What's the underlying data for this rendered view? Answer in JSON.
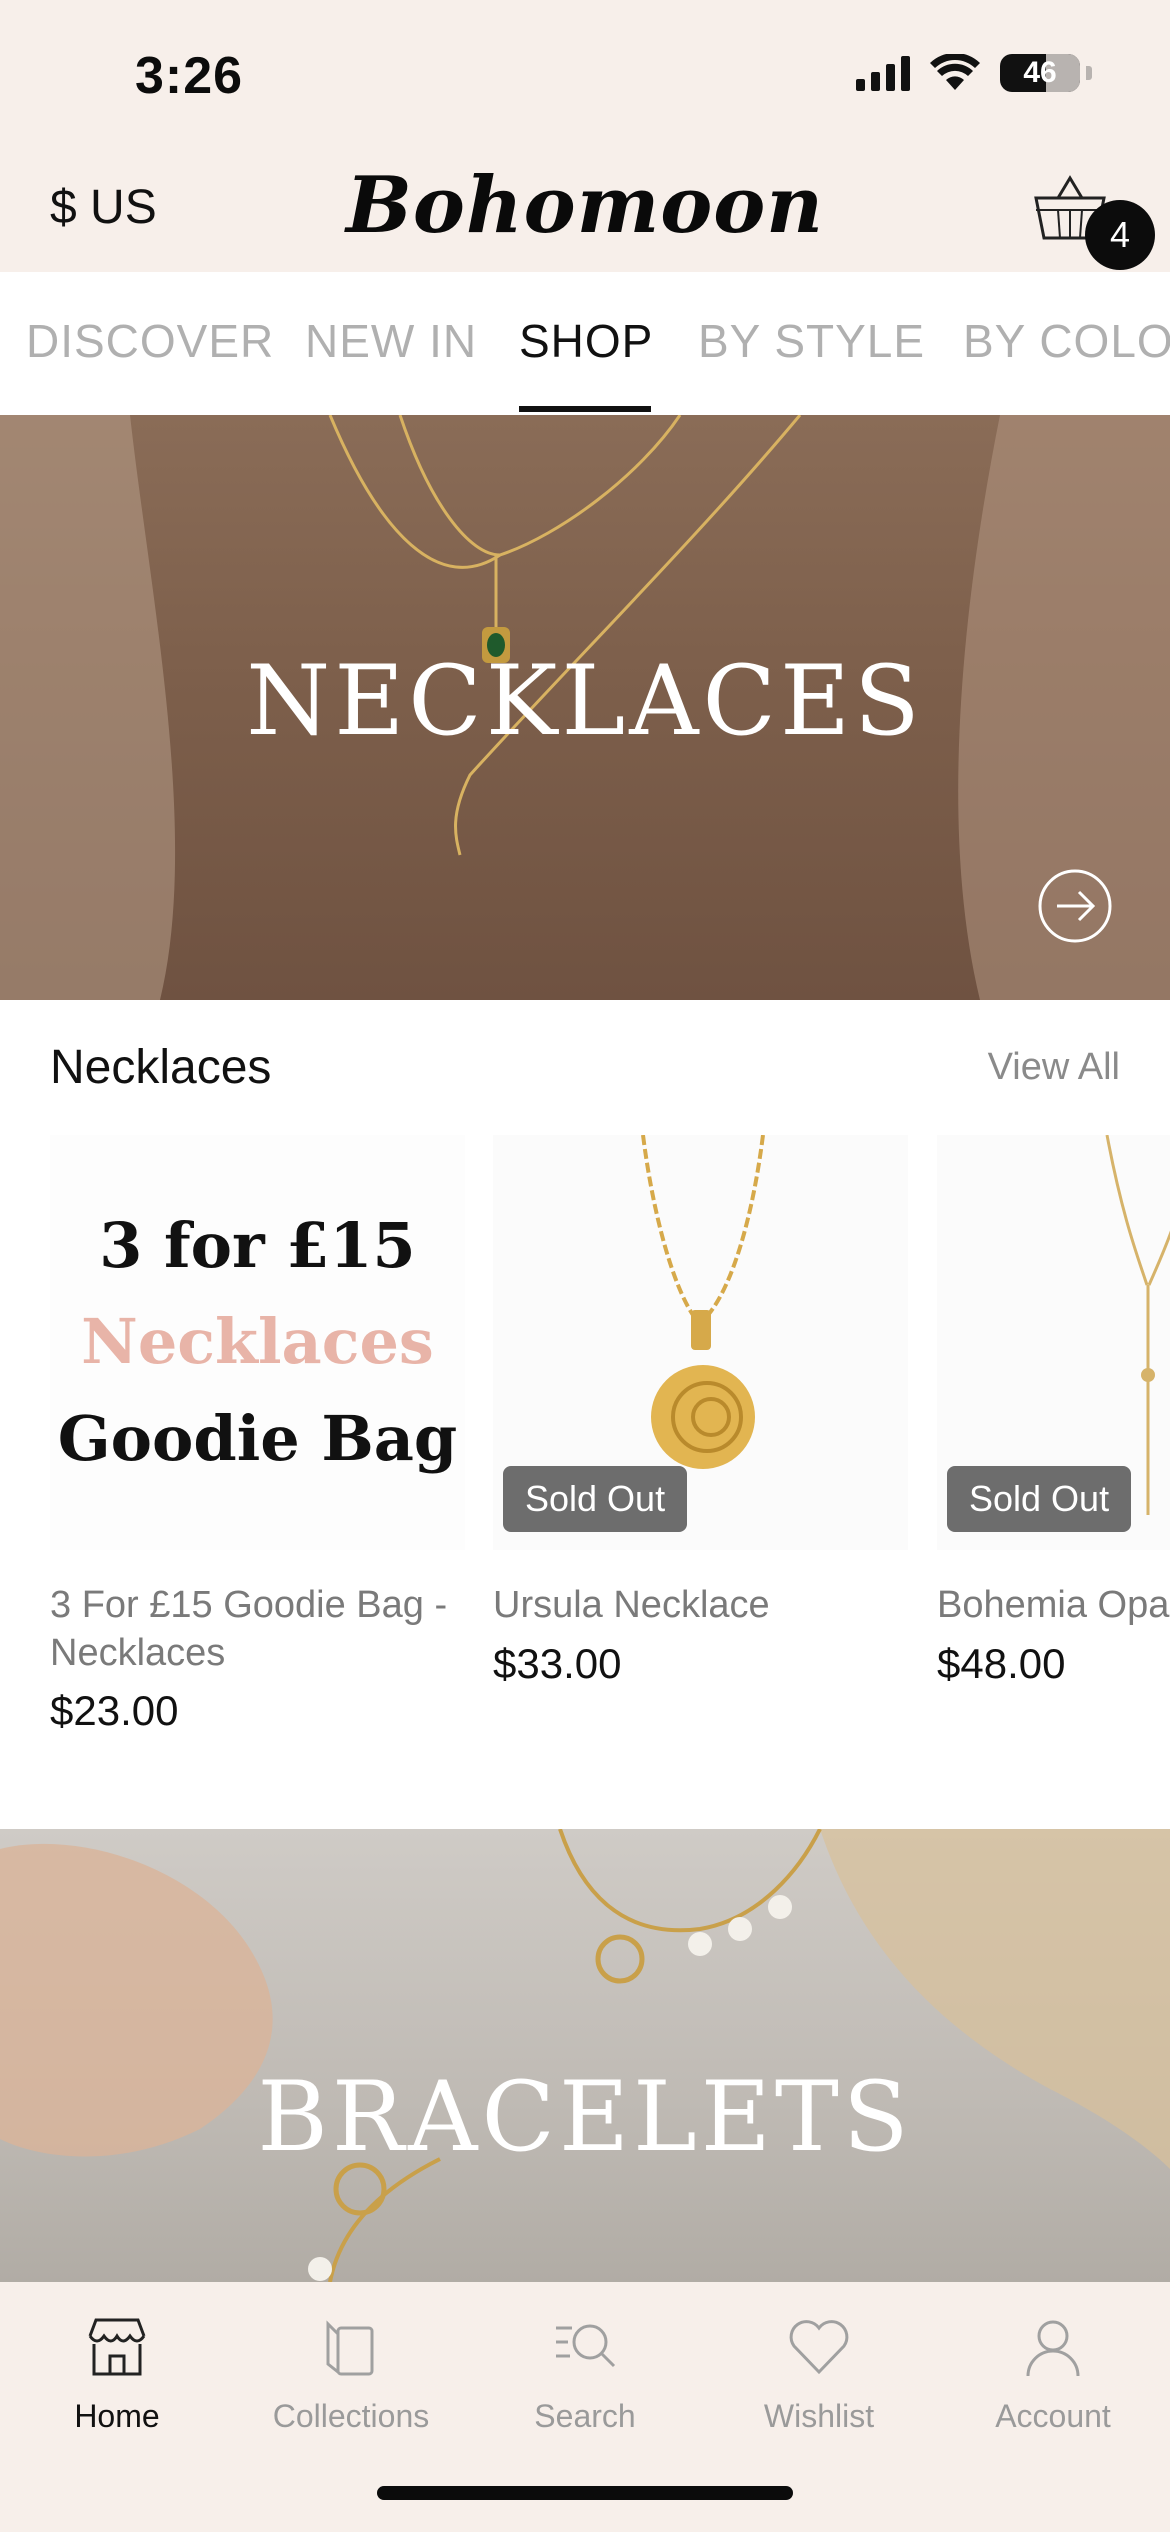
{
  "status_bar": {
    "time": "3:26",
    "battery": "46"
  },
  "header": {
    "currency": "$ US",
    "logo": "Bohomoon",
    "cart_count": "4"
  },
  "tabs": [
    {
      "label": "DISCOVER"
    },
    {
      "label": "NEW IN"
    },
    {
      "label": "SHOP"
    },
    {
      "label": "BY STYLE"
    },
    {
      "label": "BY COLOUR"
    }
  ],
  "active_tab": "SHOP",
  "banners": {
    "necklaces_title": "NECKLACES",
    "bracelets_title": "BRACELETS"
  },
  "section": {
    "title": "Necklaces",
    "view_all": "View All"
  },
  "products": [
    {
      "image_text": [
        "3 for £15",
        "Necklaces",
        "Goodie Bag"
      ],
      "name": "3 For £15 Goodie Bag - Necklaces",
      "price": "$23.00",
      "badge": ""
    },
    {
      "name": "Ursula Necklace",
      "price": "$33.00",
      "badge": "Sold Out"
    },
    {
      "name": "Bohemia Opal Necklace",
      "price": "$48.00",
      "badge": "Sold Out"
    }
  ],
  "bottom_nav": [
    {
      "label": "Home",
      "icon": "store-icon"
    },
    {
      "label": "Collections",
      "icon": "collections-icon"
    },
    {
      "label": "Search",
      "icon": "search-icon"
    },
    {
      "label": "Wishlist",
      "icon": "heart-icon"
    },
    {
      "label": "Account",
      "icon": "user-icon"
    }
  ],
  "colors": {
    "header_bg": "#f7efea",
    "accent_pink": "#e8b4a8",
    "badge_bg": "#6d6d6d"
  }
}
